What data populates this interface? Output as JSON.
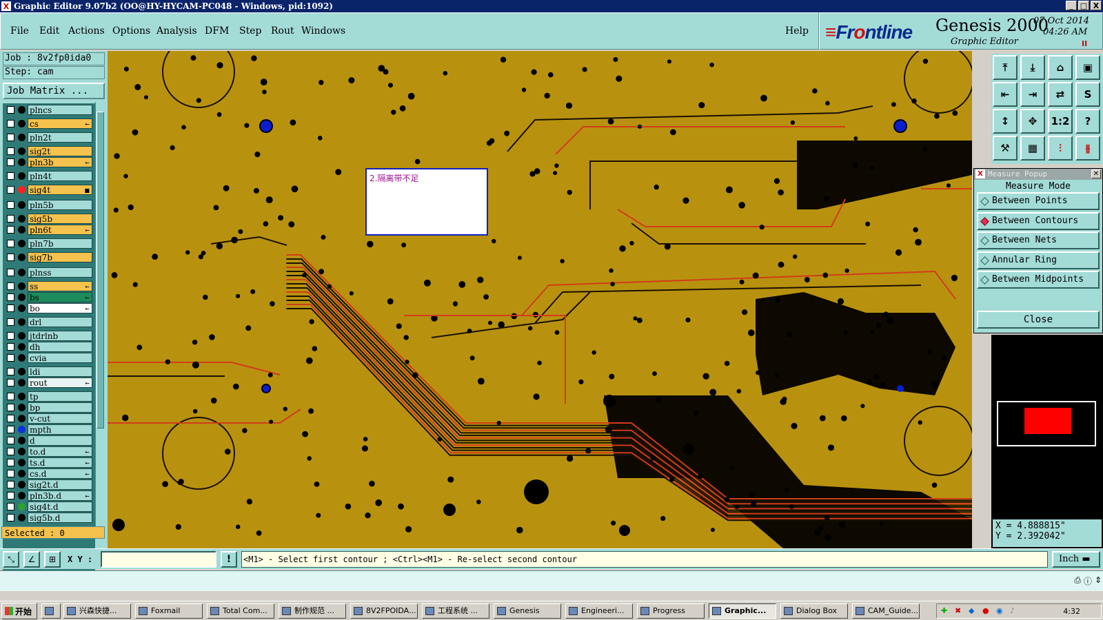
{
  "window": {
    "title": "Graphic Editor 9.07b2 (OO@HY-HYCAM-PC048 - Windows, pid:1092)",
    "controls": [
      "_",
      "□",
      "X"
    ]
  },
  "menu": {
    "items": [
      "File",
      "Edit",
      "Actions",
      "Options",
      "Analysis",
      "DFM",
      "Step",
      "Rout",
      "Windows"
    ],
    "help": "Help"
  },
  "brand": {
    "logo_prefix": "Fr",
    "logo_rest": "ntline",
    "product": "Genesis 2000",
    "subtitle": "Graphic Editor",
    "date": "07 Oct 2014",
    "time": "04:26 AM",
    "pause_glyph": "II"
  },
  "left": {
    "job": "Job : 8v2fp0ida0",
    "step": "Step: cam",
    "job_matrix": "Job Matrix ...",
    "selected": "Selected : 0",
    "layers": [
      {
        "name": "plncs",
        "color": "#a3dbd7",
        "dot": "",
        "flag": ""
      },
      {
        "name": "cs",
        "color": "#f4c24d",
        "dot": "",
        "flag": "←"
      },
      {
        "name": "pln2t",
        "color": "#a3dbd7",
        "dot": "",
        "flag": ""
      },
      {
        "name": "sig2t",
        "color": "#f4c24d",
        "dot": "",
        "flag": ""
      },
      {
        "name": "pln3b",
        "color": "#f4c24d",
        "dot": "",
        "flag": "←"
      },
      {
        "name": "pln4t",
        "color": "#a3dbd7",
        "dot": "",
        "flag": ""
      },
      {
        "name": "sig4t",
        "color": "#f4c24d",
        "dot": "#ff2020",
        "flag": "■"
      },
      {
        "name": "pln5b",
        "color": "#a3dbd7",
        "dot": "",
        "flag": ""
      },
      {
        "name": "sig5b",
        "color": "#f4c24d",
        "dot": "",
        "flag": ""
      },
      {
        "name": "pln6t",
        "color": "#f4c24d",
        "dot": "",
        "flag": "←"
      },
      {
        "name": "pln7b",
        "color": "#a3dbd7",
        "dot": "",
        "flag": ""
      },
      {
        "name": "sig7b",
        "color": "#f4c24d",
        "dot": "",
        "flag": ""
      },
      {
        "name": "plnss",
        "color": "#a3dbd7",
        "dot": "",
        "flag": ""
      },
      {
        "name": "ss",
        "color": "#f4c24d",
        "dot": "",
        "flag": "←"
      },
      {
        "name": "bs",
        "color": "#1d8c5c",
        "dot": "",
        "flag": "←"
      },
      {
        "name": "bo",
        "color": "#ffffff",
        "dot": "",
        "flag": "←"
      },
      {
        "name": "drl",
        "color": "#a3dbd7",
        "dot": "",
        "flag": ""
      },
      {
        "name": "jtdrlnb",
        "color": "#a3dbd7",
        "dot": "",
        "flag": ""
      },
      {
        "name": "dh",
        "color": "#a3dbd7",
        "dot": "",
        "flag": ""
      },
      {
        "name": "cvia",
        "color": "#a3dbd7",
        "dot": "",
        "flag": ""
      },
      {
        "name": "ldi",
        "color": "#a3dbd7",
        "dot": "",
        "flag": ""
      },
      {
        "name": "rout",
        "color": "#e8f4f3",
        "dot": "",
        "flag": "←"
      },
      {
        "name": "tp",
        "color": "#a3dbd7",
        "dot": "",
        "flag": ""
      },
      {
        "name": "bp",
        "color": "#a3dbd7",
        "dot": "",
        "flag": ""
      },
      {
        "name": "v-cut",
        "color": "#a3dbd7",
        "dot": "",
        "flag": ""
      },
      {
        "name": "mpth",
        "color": "#a3dbd7",
        "dot": "#1030e0",
        "flag": ""
      },
      {
        "name": "d",
        "color": "#a3dbd7",
        "dot": "",
        "flag": ""
      },
      {
        "name": "to.d",
        "color": "#a3dbd7",
        "dot": "",
        "flag": "←"
      },
      {
        "name": "ts.d",
        "color": "#a3dbd7",
        "dot": "",
        "flag": "←"
      },
      {
        "name": "cs.d",
        "color": "#a3dbd7",
        "dot": "",
        "flag": "←"
      },
      {
        "name": "sig2t.d",
        "color": "#a3dbd7",
        "dot": "",
        "flag": ""
      },
      {
        "name": "pln3b.d",
        "color": "#a3dbd7",
        "dot": "",
        "flag": "←"
      },
      {
        "name": "sig4t.d",
        "color": "#a3dbd7",
        "dot": "#30a030",
        "flag": ""
      },
      {
        "name": "sig5b.d",
        "color": "#a3dbd7",
        "dot": "",
        "flag": ""
      }
    ]
  },
  "canvas": {
    "note_text": "2.隔离带不足",
    "colors": {
      "board": "#b8920f",
      "copper_edge": "#1a1000",
      "trace_red": "#d23c18",
      "pad_blue": "#0a1ecf"
    }
  },
  "toolbar": {
    "tools": [
      {
        "icon": "zoom-home-icon",
        "glyph": "⤒"
      },
      {
        "icon": "zoom-down-icon",
        "glyph": "⤓"
      },
      {
        "icon": "home-icon",
        "glyph": "⌂"
      },
      {
        "icon": "fit-icon",
        "glyph": "▣"
      },
      {
        "icon": "pan-left-icon",
        "glyph": "⇤"
      },
      {
        "icon": "pan-right-icon",
        "glyph": "⇥"
      },
      {
        "icon": "pan-io-icon",
        "glyph": "⇄"
      },
      {
        "icon": "snap-icon",
        "glyph": "S"
      },
      {
        "icon": "zoom-vertical-icon",
        "glyph": "↕"
      },
      {
        "icon": "zoom-all-icon",
        "glyph": "✥"
      },
      {
        "icon": "scale-one-to-two-icon",
        "glyph": "1:2"
      },
      {
        "icon": "help-icon",
        "glyph": "?"
      },
      {
        "icon": "measure-tool-icon",
        "glyph": "⚒"
      },
      {
        "icon": "grid-icon",
        "glyph": "▦"
      },
      {
        "icon": "net-highlight-icon",
        "glyph": "⫶"
      },
      {
        "icon": "net-select-icon",
        "glyph": "⫵"
      }
    ]
  },
  "measure_popup": {
    "title": "Measure Popup",
    "heading": "Measure Mode",
    "options": [
      "Between Points",
      "Between Contours",
      "Between Nets",
      "Annular Ring",
      "Between Midpoints"
    ],
    "selected_index": 1,
    "close": "Close"
  },
  "coords": {
    "x": "X = 4.888815\"",
    "y": "Y = 2.392042\""
  },
  "command": {
    "xy_label": "X Y :",
    "xy_value": "",
    "prompt": "<M1> - Select first contour ; <Ctrl><M1> - Re-select second contour",
    "unit": "Inch"
  },
  "taskbar": {
    "start": "开始",
    "tasks": [
      {
        "label": "兴森快捷...",
        "active": false
      },
      {
        "label": "Foxmail",
        "active": false
      },
      {
        "label": "Total Com...",
        "active": false
      },
      {
        "label": "制作规范 ...",
        "active": false
      },
      {
        "label": "8V2FPOIDA...",
        "active": false
      },
      {
        "label": "工程系统 ...",
        "active": false
      },
      {
        "label": "Genesis",
        "active": false
      },
      {
        "label": "Engineeri...",
        "active": false
      },
      {
        "label": "Progress",
        "active": false
      },
      {
        "label": "Graphic...",
        "active": true
      },
      {
        "label": "Dialog Box",
        "active": false
      },
      {
        "label": "CAM_Guide...",
        "active": false
      }
    ],
    "clock": "4:32"
  }
}
